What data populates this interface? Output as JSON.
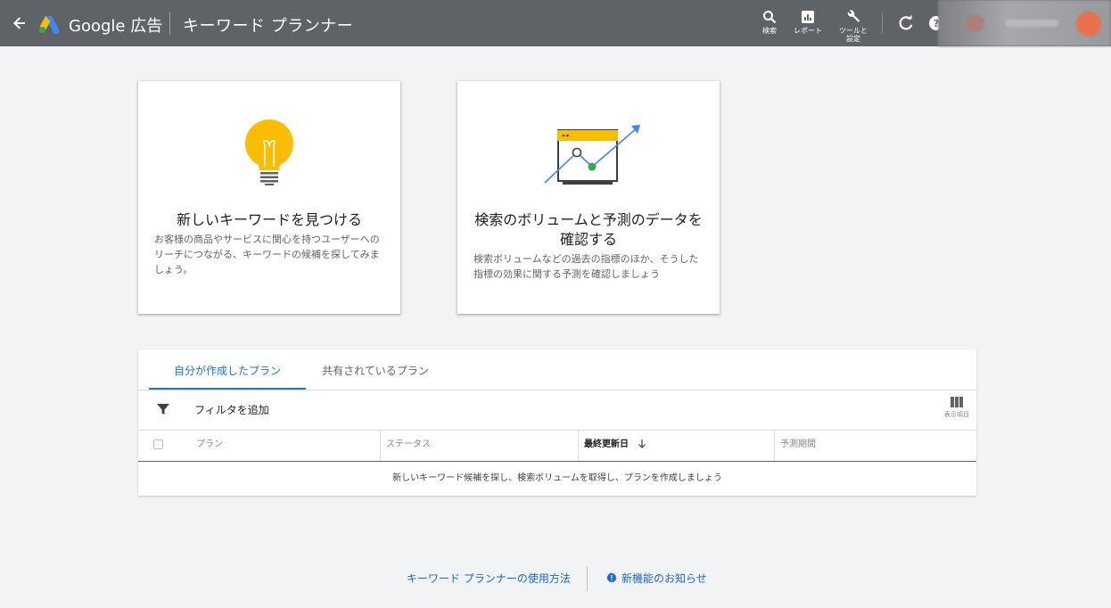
{
  "header": {
    "brand": "Google 広告",
    "page_title": "キーワード プランナー",
    "tools": [
      {
        "label": "検索",
        "icon": "search-icon"
      },
      {
        "label": "レポート",
        "icon": "bar-chart-icon"
      },
      {
        "label": "ツールと\n設定",
        "icon": "wrench-icon"
      }
    ],
    "icons": [
      "back-arrow-icon",
      "google-ads-logo",
      "refresh-icon",
      "help-icon"
    ]
  },
  "cards": [
    {
      "title": "新しいキーワードを見つける",
      "description": "お客様の商品やサービスに関心を持つユーザーへのリーチにつながる、キーワードの候補を探してみましょう。",
      "icon": "lightbulb-icon"
    },
    {
      "title": "検索のボリュームと予測のデータを確認する",
      "description": "検索ボリュームなどの過去の指標のほか、そうした指標の効果に関する予測を確認しましょう",
      "icon": "growth-chart-icon"
    }
  ],
  "plans": {
    "tabs": [
      "自分が作成したプラン",
      "共有されているプラン"
    ],
    "active_tab": 0,
    "filter_label": "フィルタを追加",
    "columns_label": "表示項目",
    "columns": [
      "プラン",
      "ステータス",
      "最終更新日",
      "予測期間"
    ],
    "sorted_column": "最終更新日",
    "empty_message": "新しいキーワード候補を探し、検索ボリュームを取得し、プランを作成しましょう"
  },
  "footer": {
    "howto_link": "キーワード プランナーの使用方法",
    "news_link": "新機能のお知らせ"
  },
  "colors": {
    "topbar": "#5f6368",
    "background": "#f1f3f4",
    "accent": "#1a73e8",
    "bulb": "#fbbc04",
    "chart_dot": "#34a853"
  }
}
